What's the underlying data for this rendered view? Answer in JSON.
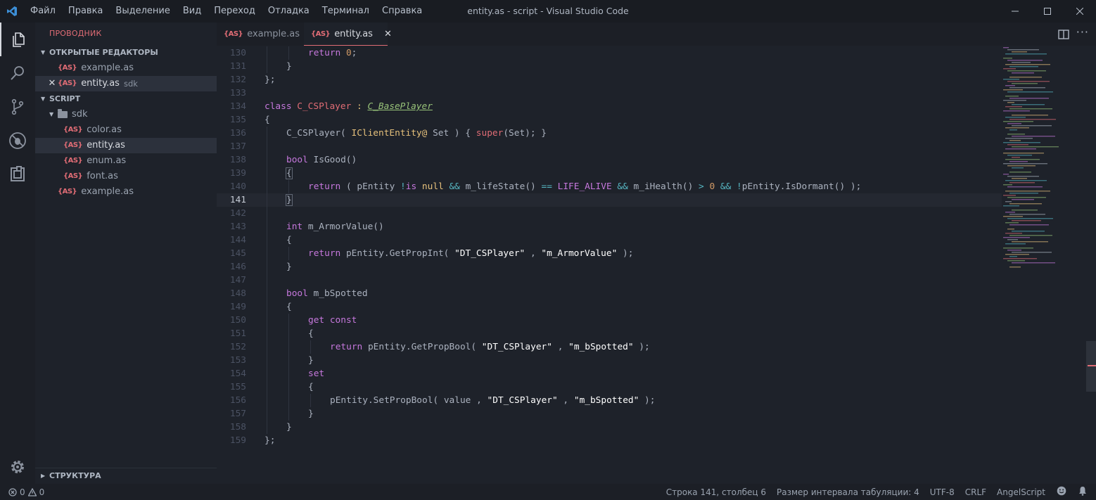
{
  "window": {
    "title": "entity.as - script - Visual Studio Code",
    "menu": [
      "Файл",
      "Правка",
      "Выделение",
      "Вид",
      "Переход",
      "Отладка",
      "Терминал",
      "Справка"
    ]
  },
  "sidebar": {
    "title": "ПРОВОДНИК",
    "open_editors": {
      "label": "ОТКРЫТЫЕ РЕДАКТОРЫ",
      "items": [
        {
          "name": "example.as"
        },
        {
          "name": "entity.as",
          "desc": "sdk"
        }
      ]
    },
    "workspace": {
      "label": "SCRIPT",
      "folder": "sdk",
      "sdk_files": [
        "color.as",
        "entity.as",
        "enum.as",
        "font.as"
      ],
      "root_files": [
        "example.as"
      ]
    },
    "outline_label": "СТРУКТУРА",
    "file_icon_text": "{AS}"
  },
  "tabs": [
    {
      "label": "example.as"
    },
    {
      "label": "entity.as"
    }
  ],
  "editor": {
    "current_line": 141,
    "lines": [
      "130",
      "131",
      "132",
      "133",
      "134",
      "135",
      "136",
      "137",
      "138",
      "139",
      "140",
      "141",
      "142",
      "143",
      "144",
      "145",
      "146",
      "147",
      "148",
      "149",
      "150",
      "151",
      "152",
      "153",
      "154",
      "155",
      "156",
      "157",
      "158",
      "159"
    ]
  },
  "statusbar": {
    "errors": "0",
    "warnings": "0",
    "position": "Строка 141, столбец 6",
    "indent": "Размер интервала табуляции: 4",
    "encoding": "UTF-8",
    "eol": "CRLF",
    "language": "AngelScript"
  },
  "colors": {
    "accent": "#e06c75",
    "background": "#1e222a",
    "keyword": "#c678dd",
    "string": "#ffffff",
    "type": "#e5c07b"
  }
}
